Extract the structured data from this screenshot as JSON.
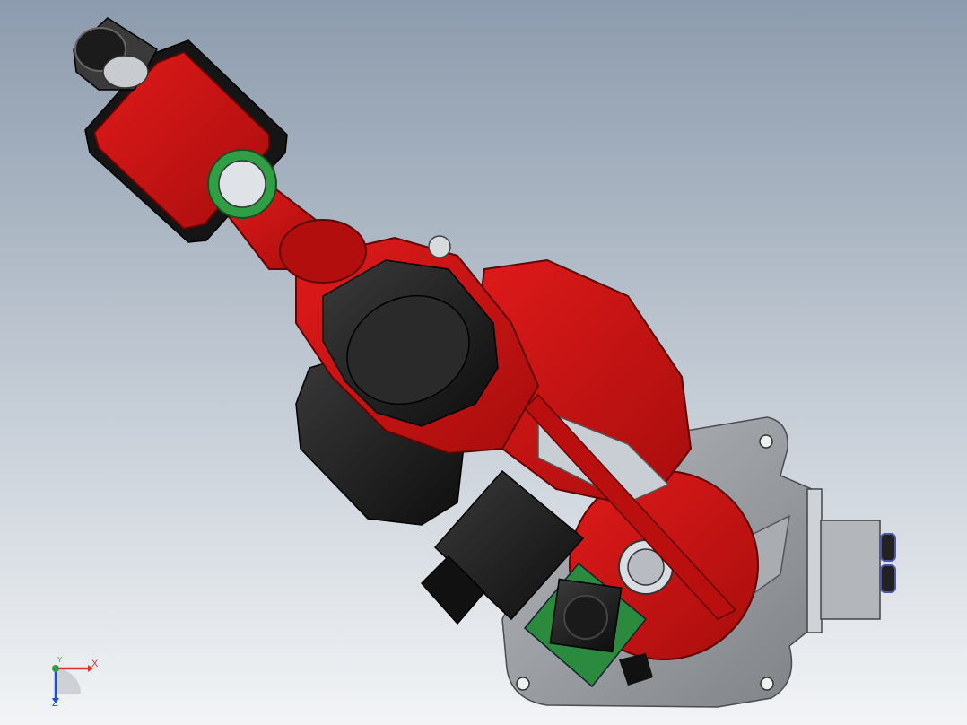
{
  "viewport": {
    "background_top": "#8c9bad",
    "background_bottom": "#f2f4f6",
    "colors": {
      "robot_red": "#cc1111",
      "robot_red_dark": "#7a0606",
      "motor_black": "#1c1c1c",
      "base_gray": "#9a9da2",
      "seal_green": "#2f9e44",
      "axis_x": "#e03131",
      "axis_y": "#2f9e44",
      "axis_z": "#1c4fd6"
    }
  },
  "triad": {
    "x_label": "X",
    "y_label": "Y",
    "z_label": "Z"
  }
}
